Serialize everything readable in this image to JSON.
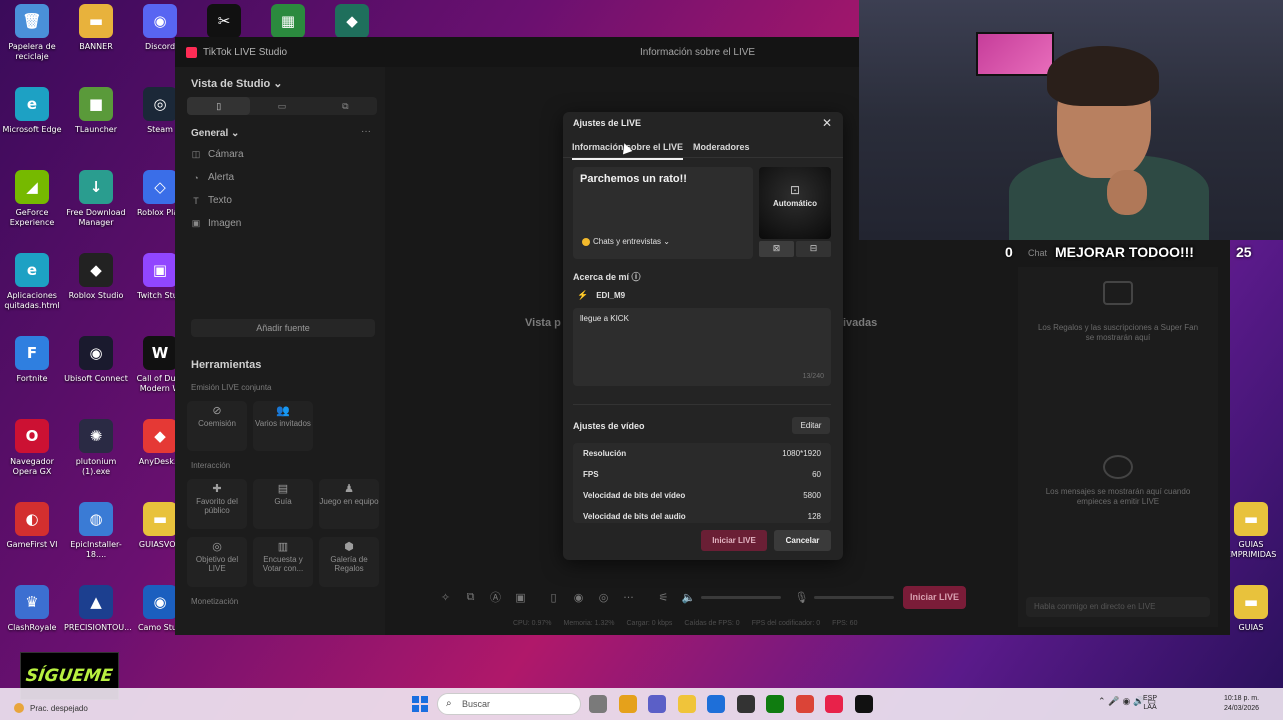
{
  "desktop": {
    "icons": [
      {
        "label": "Papelera de reciclaje",
        "color": "#4a90d9",
        "glyph": "🗑"
      },
      {
        "label": "BANNER",
        "color": "#e8b23c",
        "glyph": "▬"
      },
      {
        "label": "Discord",
        "color": "#5865f2",
        "glyph": "◉"
      },
      {
        "label": "",
        "color": "#111111",
        "glyph": "✂"
      },
      {
        "label": "",
        "color": "#2b8a3e",
        "glyph": "▦"
      },
      {
        "label": "",
        "color": "#1f6f5c",
        "glyph": "◆"
      },
      {
        "label": "Microsoft Edge",
        "color": "#1da1c4",
        "glyph": "e"
      },
      {
        "label": "TLauncher",
        "color": "#5a9a3a",
        "glyph": "■"
      },
      {
        "label": "Steam",
        "color": "#1b2838",
        "glyph": "◎"
      },
      {
        "label": "GeForce Experience",
        "color": "#76b900",
        "glyph": "◢"
      },
      {
        "label": "Free Download Manager",
        "color": "#2a9d8f",
        "glyph": "↓"
      },
      {
        "label": "Roblox Play",
        "color": "#3a6ee8",
        "glyph": "◇"
      },
      {
        "label": "Aplicaciones quitadas.html",
        "color": "#1da1c4",
        "glyph": "e"
      },
      {
        "label": "Roblox Studio",
        "color": "#222222",
        "glyph": "◆"
      },
      {
        "label": "Twitch Stud",
        "color": "#9146ff",
        "glyph": "▣"
      },
      {
        "label": "Fortnite",
        "color": "#2f7fe0",
        "glyph": "F"
      },
      {
        "label": "Ubisoft Connect",
        "color": "#1a1a2e",
        "glyph": "◉"
      },
      {
        "label": "Call of Duty Modern W",
        "color": "#111111",
        "glyph": "W"
      },
      {
        "label": "Navegador Opera GX",
        "color": "#cc1133",
        "glyph": "O"
      },
      {
        "label": "plutonium (1).exe",
        "color": "#2a2a44",
        "glyph": "✺"
      },
      {
        "label": "AnyDesk.e",
        "color": "#e53935",
        "glyph": "◆"
      },
      {
        "label": "GameFirst VI",
        "color": "#d32f2f",
        "glyph": "◐"
      },
      {
        "label": "EpicInstaller-18....",
        "color": "#3a7bd5",
        "glyph": "◍"
      },
      {
        "label": "GUIASVOC",
        "color": "#e8c23c",
        "glyph": "▬"
      },
      {
        "label": "ClashRoyale",
        "color": "#3c6fd1",
        "glyph": "♛"
      },
      {
        "label": "PRECISIONTOU...",
        "color": "#1c3f8f",
        "glyph": "▲"
      },
      {
        "label": "Camo Stud",
        "color": "#1b5fbf",
        "glyph": "◉"
      },
      {
        "label": "GUIAS EMPRIMIDAS",
        "color": "#e8c23c",
        "glyph": "▬"
      },
      {
        "label": "GUIAS",
        "color": "#e8c23c",
        "glyph": "▬"
      }
    ]
  },
  "studio": {
    "app_title": "TikTok LIVE Studio",
    "center_title": "Información sobre el LIVE",
    "view_label": "Vista de Studio ⌄",
    "general_label": "General ⌄",
    "more": "···",
    "sources": [
      {
        "icon": "◫",
        "label": "Cámara"
      },
      {
        "icon": "◔",
        "label": "Alerta"
      },
      {
        "icon": "T",
        "label": "Texto"
      },
      {
        "icon": "▣",
        "label": "Imagen"
      }
    ],
    "add_source": "Añadir fuente",
    "tools_title": "Herramientas",
    "joint_caption": "Emisión LIVE conjunta",
    "interaction_caption": "Interacción",
    "monetization_caption": "Monetización",
    "joint_tools": [
      {
        "icon": "⊘",
        "label": "Coemisión"
      },
      {
        "icon": "👥",
        "label": "Varios invitados"
      }
    ],
    "interaction_tools": [
      {
        "icon": "✚",
        "label": "Favorito del público"
      },
      {
        "icon": "▤",
        "label": "Guía"
      },
      {
        "icon": "♟",
        "label": "Juego en equipo"
      },
      {
        "icon": "◎",
        "label": "Objetivo del LIVE"
      },
      {
        "icon": "▥",
        "label": "Encuesta y Votar con..."
      },
      {
        "icon": "⬢",
        "label": "Galería de Regalos"
      }
    ],
    "preview_left": "Vista p",
    "preview_right": "ivadas",
    "gifts_text": "Los Regalos y las suscripciones a Super Fan se mostrarán aquí",
    "messages_text": "Los mensajes se mostrarán aquí cuando empieces a emitir LIVE",
    "chat_placeholder": "Habla conmigo en directo en LIVE",
    "start_button": "Iniciar LIVE",
    "stats": [
      "CPU: 0.97%",
      "Memoria: 1.32%",
      "Cargar: 0 kbps",
      "Caídas de FPS: 0",
      "FPS del codificador: 0",
      "FPS: 60"
    ]
  },
  "modal": {
    "title": "Ajustes de LIVE",
    "close": "✕",
    "tabs": [
      "Información sobre el LIVE",
      "Moderadores"
    ],
    "live_title": "Parchemos un rato!!",
    "category": "Chats y entrevistas ⌄",
    "cover_icon": "⊡",
    "cover_label": "Automático",
    "cover_btn_1": "⊠",
    "cover_btn_2": "⊟",
    "about_label": "Acerca de mí ⓘ",
    "user_icon": "⚡",
    "username": "EDI_M9",
    "bio": "llegue a KICK",
    "bio_count": "13/240",
    "video_settings_label": "Ajustes de vídeo",
    "edit_button": "Editar",
    "video_rows": [
      {
        "key": "Resolución",
        "value": "1080*1920"
      },
      {
        "key": "FPS",
        "value": "60"
      },
      {
        "key": "Velocidad de bits del vídeo",
        "value": "5800"
      },
      {
        "key": "Velocidad de bits del audio",
        "value": "128"
      }
    ],
    "start_button": "Iniciar LIVE",
    "cancel_button": "Cancelar"
  },
  "webcam": {
    "left_count": "0",
    "chat_label": "Chat",
    "goal_text": "MEJORAR TODOO!!!",
    "right_count": "25"
  },
  "badge": {
    "text": "SÍGUEME"
  },
  "taskbar": {
    "weather": "Prac. despejado",
    "search_placeholder": "Buscar",
    "search_icon": "⌕",
    "tray_icons": "⌃  🎤  ◉  🔊  ▭",
    "lang_line1": "ESP",
    "lang_line2": "LAA",
    "time": "10:18 p. m.",
    "date": "24/03/2026",
    "apps": [
      {
        "color": "#7a7a7a"
      },
      {
        "color": "#e5a11b"
      },
      {
        "color": "#5b5fc7"
      },
      {
        "color": "#f0c43a"
      },
      {
        "color": "#1e6fd9"
      },
      {
        "color": "#333333"
      },
      {
        "color": "#107c10"
      },
      {
        "color": "#db4437"
      },
      {
        "color": "#e8224a"
      },
      {
        "color": "#111111"
      }
    ]
  }
}
